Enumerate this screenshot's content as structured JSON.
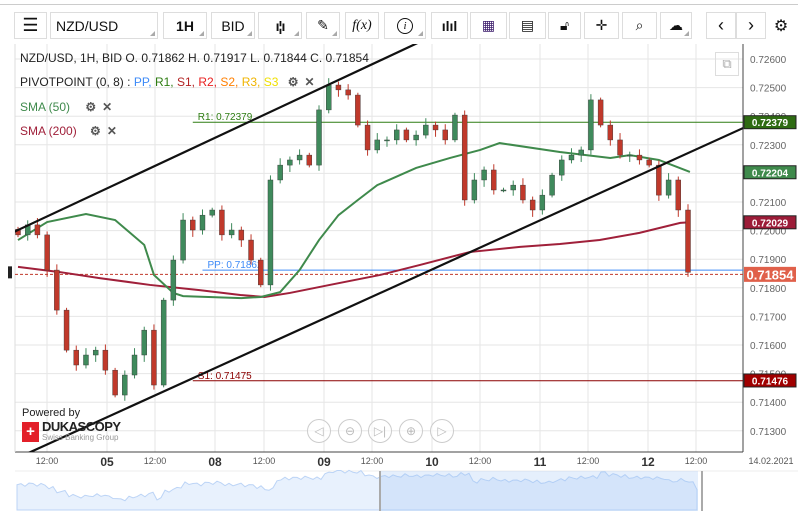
{
  "toolbar": {
    "menu_icon": "hamburger-icon",
    "symbol": "NZD/USD",
    "timeframe": "1H",
    "side": "BID",
    "buttons": [
      "chart-type-icon",
      "pen-icon",
      "fx-icon",
      "info-icon",
      "bar-chart-icon",
      "calendar-icon",
      "news-icon",
      "lock-icon",
      "crosshair-icon",
      "zoom-chart-icon",
      "cloud-upload-icon",
      "chevron-left-icon",
      "chevron-right-icon",
      "gear-icon"
    ],
    "fx_label": "f(x)"
  },
  "legend": {
    "ohlc": "NZD/USD, 1H, BID   O. 0.71862 H. 0.71917 L. 0.71844 C. 0.71854",
    "pivot_name": "PIVOTPOINT (0, 8)",
    "pivot_sep": " : ",
    "pivot_items": [
      {
        "label": "PP",
        "color": "#3d8af7"
      },
      {
        "label": "R1",
        "color": "#2e7d12"
      },
      {
        "label": "S1",
        "color": "#b22222"
      },
      {
        "label": "R2",
        "color": "#e82020"
      },
      {
        "label": "S2",
        "color": "#ff7f00"
      },
      {
        "label": "R3",
        "color": "#f0b400"
      },
      {
        "label": "S3",
        "color": "#f0e000"
      }
    ],
    "sma50": {
      "label": "SMA (50)",
      "color": "#3f8a4c"
    },
    "sma200": {
      "label": "SMA (200)",
      "color": "#a0203a"
    }
  },
  "branding": {
    "powered_by": "Powered by",
    "logo_text": "DUKASCOPY",
    "tagline": "Swiss Banking Group"
  },
  "chart_data": {
    "type": "candlestick",
    "symbol": "NZD/USD",
    "ylim": [
      0.7125,
      0.7265
    ],
    "y_ticks": [
      "0.72600",
      "0.72500",
      "0.72400",
      "0.72300",
      "0.72200",
      "0.72100",
      "0.72000",
      "0.71900",
      "0.71800",
      "0.71700",
      "0.71600",
      "0.71500",
      "0.71400",
      "0.71300"
    ],
    "x_ticks": [
      {
        "label": "12:00",
        "bold": false
      },
      {
        "label": "05",
        "bold": true
      },
      {
        "label": "12:00",
        "bold": false
      },
      {
        "label": "08",
        "bold": true
      },
      {
        "label": "12:00",
        "bold": false
      },
      {
        "label": "09",
        "bold": true
      },
      {
        "label": "12:00",
        "bold": false
      },
      {
        "label": "10",
        "bold": true
      },
      {
        "label": "12:00",
        "bold": false
      },
      {
        "label": "11",
        "bold": true
      },
      {
        "label": "12:00",
        "bold": false
      },
      {
        "label": "12",
        "bold": true
      },
      {
        "label": "12:00",
        "bold": false
      },
      {
        "label": "14.02.2021",
        "bold": false
      }
    ],
    "closes": [
      0.71985,
      0.7202,
      0.71985,
      0.71862,
      0.71722,
      0.71582,
      0.7153,
      0.71565,
      0.71582,
      0.71512,
      0.71425,
      0.71495,
      0.71565,
      0.71652,
      0.7146,
      0.71757,
      0.71897,
      0.72037,
      0.72002,
      0.72054,
      0.72072,
      0.71985,
      0.72002,
      0.71967,
      0.71897,
      0.7181,
      0.72177,
      0.72229,
      0.72247,
      0.72264,
      0.72229,
      0.72422,
      0.72509,
      0.72492,
      0.72474,
      0.72369,
      0.72282,
      0.72317,
      0.72317,
      0.72352,
      0.72317,
      0.72334,
      0.72369,
      0.72352,
      0.72317,
      0.72404,
      0.72107,
      0.72177,
      0.72212,
      0.72142,
      0.72142,
      0.72159,
      0.72107,
      0.72072,
      0.72124,
      0.72194,
      0.72247,
      0.72264,
      0.72282,
      0.72457,
      0.72369,
      0.72317,
      0.72264,
      0.72264,
      0.72247,
      0.72229,
      0.72124,
      0.72177,
      0.72072,
      0.71854
    ],
    "sma50": [
      [
        0,
        0.71967
      ],
      [
        3,
        0.7203
      ],
      [
        7,
        0.72058
      ],
      [
        10,
        0.72037
      ],
      [
        13,
        0.7195
      ],
      [
        14,
        0.71845
      ],
      [
        16,
        0.71782
      ],
      [
        17,
        0.71771
      ],
      [
        23,
        0.71764
      ],
      [
        25,
        0.71768
      ],
      [
        27,
        0.71785
      ],
      [
        29,
        0.71862
      ],
      [
        31,
        0.71967
      ],
      [
        33,
        0.72054
      ],
      [
        35,
        0.72107
      ],
      [
        37,
        0.72159
      ],
      [
        41,
        0.72219
      ],
      [
        44.5,
        0.72254
      ],
      [
        47.6,
        0.72282
      ],
      [
        49.6,
        0.72306
      ],
      [
        55.8,
        0.72275
      ],
      [
        61,
        0.72254
      ],
      [
        63,
        0.72264
      ],
      [
        66,
        0.72247
      ],
      [
        69.2,
        0.72205
      ]
    ],
    "sma200": [
      [
        0,
        0.71873
      ],
      [
        4.3,
        0.71855
      ],
      [
        8.4,
        0.71834
      ],
      [
        13.6,
        0.7181
      ],
      [
        18.7,
        0.71792
      ],
      [
        22.9,
        0.71775
      ],
      [
        25.4,
        0.71768
      ],
      [
        28,
        0.71782
      ],
      [
        32.1,
        0.7181
      ],
      [
        37.3,
        0.71845
      ],
      [
        41.4,
        0.7188
      ],
      [
        46.5,
        0.71925
      ],
      [
        51.7,
        0.71943
      ],
      [
        55.8,
        0.71953
      ],
      [
        59.9,
        0.71967
      ],
      [
        64,
        0.71992
      ],
      [
        68.2,
        0.72027
      ],
      [
        69.2,
        0.72029
      ]
    ],
    "trendlines": [
      {
        "from": [
          0,
          0.72002
        ],
        "to": [
          40.9,
          0.72652
        ]
      },
      {
        "from": [
          1.75,
          0.71233
        ],
        "to": [
          74.7,
          0.72359
        ]
      }
    ],
    "pivots": [
      {
        "label": "R1: 0.72379",
        "value": 0.72379,
        "color": "#2e7d12",
        "start": 18
      },
      {
        "label": "PP: 0.71862",
        "value": 0.71862,
        "color": "#3d8af7",
        "start": 19
      },
      {
        "label": "S1: 0.71475",
        "value": 0.71475,
        "color": "#8b0000",
        "start": 18
      }
    ],
    "price_tags": [
      {
        "label": "0.72379",
        "value": 0.72379,
        "color": "#2e6b12"
      },
      {
        "label": "0.72204",
        "value": 0.72204,
        "color": "#3f8a4c"
      },
      {
        "label": "0.72029",
        "value": 0.72029,
        "color": "#9c1c38"
      },
      {
        "label": "0.71854",
        "value": 0.71854,
        "color": "#e0604a",
        "current": true
      },
      {
        "label": "0.71476",
        "value": 0.71476,
        "color": "#a00000"
      }
    ],
    "colors": {
      "up": "#3f8a5c",
      "down": "#c0392b"
    }
  }
}
